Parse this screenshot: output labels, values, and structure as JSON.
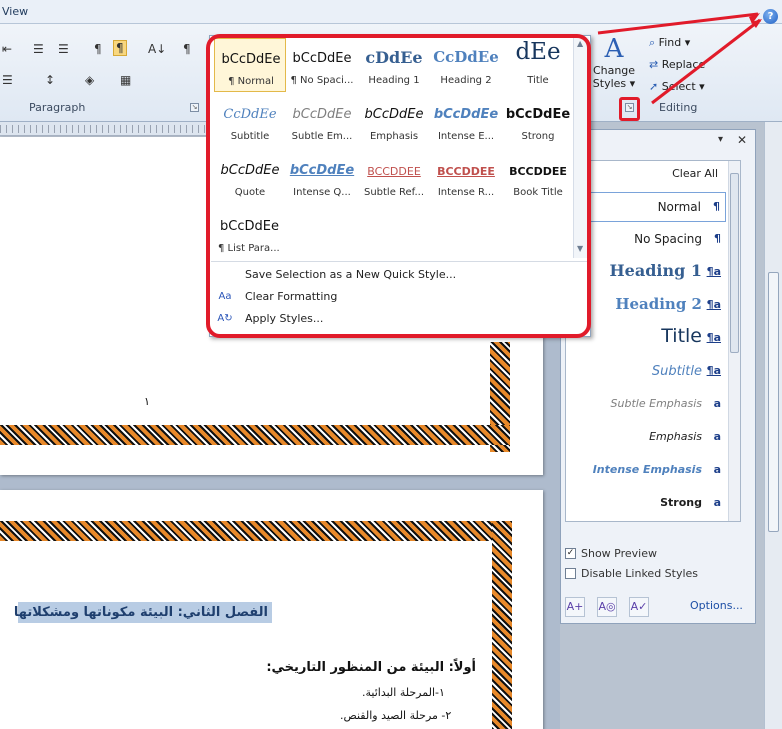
{
  "ribbon": {
    "tab_view": "View",
    "help": "?",
    "paragraph_group": "Paragraph",
    "editing_group": "Editing",
    "change_styles": {
      "letter": "A",
      "line1": "Change",
      "line2": "Styles ▾"
    },
    "find": "Find ▾",
    "replace": "Replace",
    "select": "Select ▾",
    "pilcrow": "¶",
    "sort": "A↓",
    "show_marks": "¶"
  },
  "gallery": {
    "styles": [
      {
        "preview": "bCcDdEe",
        "label": "¶ Normal"
      },
      {
        "preview": "bCcDdEe",
        "label": "¶ No Spaci..."
      },
      {
        "preview": "cDdEe",
        "label": "Heading 1"
      },
      {
        "preview": "CcDdEe",
        "label": "Heading 2"
      },
      {
        "preview": "dEe",
        "label": "Title"
      },
      {
        "preview": "CcDdEe",
        "label": "Subtitle"
      },
      {
        "preview": "bCcDdEe",
        "label": "Subtle Em..."
      },
      {
        "preview": "bCcDdEe",
        "label": "Emphasis"
      },
      {
        "preview": "bCcDdEe",
        "label": "Intense E..."
      },
      {
        "preview": "bCcDdEe",
        "label": "Strong"
      },
      {
        "preview": "bCcDdEe",
        "label": "Quote"
      },
      {
        "preview": "bCcDdEe",
        "label": "Intense Q..."
      },
      {
        "preview": "BCCDDEE",
        "label": "Subtle Ref..."
      },
      {
        "preview": "BCCDDEE",
        "label": "Intense R..."
      },
      {
        "preview": "BCCDDEE",
        "label": "Book Title"
      },
      {
        "preview": "bCcDdEe",
        "label": "¶ List Para..."
      }
    ],
    "commands": [
      {
        "label": "Save Selection as a New Quick Style...",
        "icon": "save-style-icon"
      },
      {
        "label": "Clear Formatting",
        "icon": "clear-formatting-icon"
      },
      {
        "label": "Apply Styles...",
        "icon": "apply-styles-icon"
      }
    ]
  },
  "styles_pane": {
    "clear_all": "Clear All",
    "items": [
      {
        "name": "Normal",
        "mark": "¶"
      },
      {
        "name": "No Spacing",
        "mark": "¶"
      },
      {
        "name": "Heading 1",
        "mark": "¶a"
      },
      {
        "name": "Heading 2",
        "mark": "¶a"
      },
      {
        "name": "Title",
        "mark": "¶a"
      },
      {
        "name": "Subtitle",
        "mark": "¶a"
      },
      {
        "name": "Subtle Emphasis",
        "mark": "a"
      },
      {
        "name": "Emphasis",
        "mark": "a"
      },
      {
        "name": "Intense Emphasis",
        "mark": "a"
      },
      {
        "name": "Strong",
        "mark": "a"
      }
    ],
    "show_preview": "Show Preview",
    "show_preview_checked": true,
    "disable_linked": "Disable Linked Styles",
    "disable_linked_checked": false,
    "options": "Options...",
    "check_mark": "✓"
  },
  "document": {
    "page_number": "١",
    "chapter_title": "الفصل الثاني: البيئة مكوناتها ومشكلاتها",
    "section_heading": "أولاً: البيئة من المنظور التاريخي:",
    "line1": "١-المرحلة البدائية.",
    "line2": "٢- مرحلة الصيد والقنص."
  },
  "colors": {
    "annotation_red": "#e11b2a",
    "heading_blue": "#365f91",
    "highlight": "#b8cce4"
  }
}
